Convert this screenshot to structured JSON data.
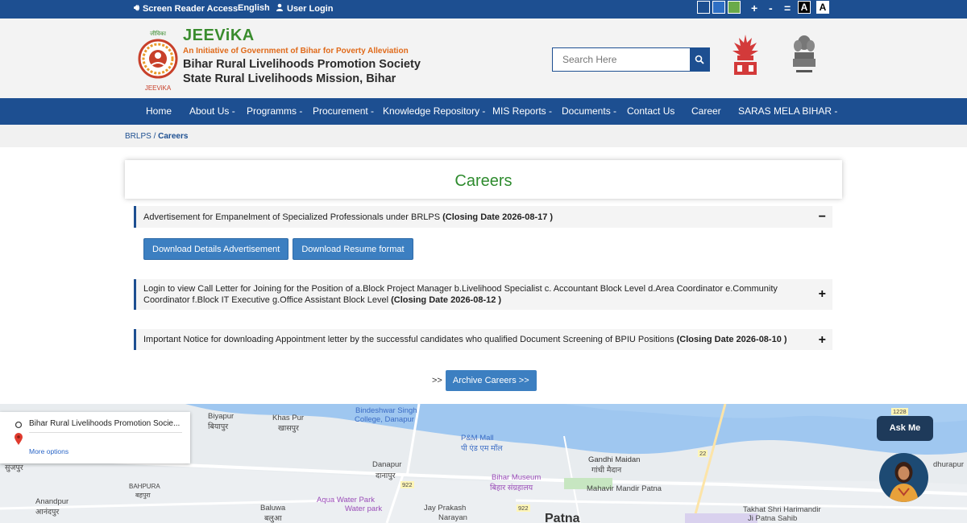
{
  "topbar": {
    "screen_reader": "Screen Reader Access",
    "language": "English",
    "user_login": "User Login",
    "font_increase": "+",
    "font_decrease": "-",
    "font_reset": "=",
    "contrast_dark": "A",
    "contrast_light": "A",
    "theme_colors": [
      "#1d4f91",
      "#2e6fc4",
      "#6aaa4a"
    ]
  },
  "header": {
    "logo_text": "JEEViKA",
    "brand_name": "JEEViKA",
    "tagline": "An Initiative of Government of Bihar for Poverty Alleviation",
    "org_line1": "Bihar Rural Livelihoods Promotion Society",
    "org_line2": "State Rural Livelihoods Mission, Bihar",
    "search_placeholder": "Search Here"
  },
  "nav": {
    "items": [
      {
        "label": "Home"
      },
      {
        "label": "About Us -"
      },
      {
        "label": "Programms -"
      },
      {
        "label": "Procurement -"
      },
      {
        "label": "Knowledge Repository -"
      },
      {
        "label": "MIS Reports -"
      },
      {
        "label": "Documents -"
      },
      {
        "label": "Contact Us"
      },
      {
        "label": "Career"
      },
      {
        "label": "SARAS MELA BIHAR -"
      }
    ]
  },
  "breadcrumb": {
    "root": "BRLPS",
    "separator": " / ",
    "current": "Careers"
  },
  "page": {
    "title": "Careers"
  },
  "careers": [
    {
      "text": "Advertisement for Empanelment of Specialized Professionals under BRLPS",
      "closing": "(Closing Date 2026-08-17 )",
      "sign": "−",
      "buttons": [
        "Download Details Advertisement",
        "Download Resume format"
      ]
    },
    {
      "text": "Login to view Call Letter for Joining for the Position of a.Block Project Manager b.Livelihood Specialist c. Accountant Block Level d.Area Coordinator e.Community Coordinator f.Block IT Executive g.Office Assistant Block Level",
      "closing": "(Closing Date 2026-08-12 )",
      "sign": "+"
    },
    {
      "text": "Important Notice for downloading Appointment letter by the successful candidates who qualified Document Screening of BPIU Positions",
      "closing": "(Closing Date 2026-08-10 )",
      "sign": "+"
    }
  ],
  "archive": {
    "prefix": ">>",
    "label": "Archive Careers >>"
  },
  "map": {
    "info_title": "Bihar Rural Livelihoods Promotion Socie...",
    "info_more": "More options",
    "labels": [
      "Bindeshwar Singh",
      "College, Danapur",
      "Biyapur",
      "बियापुर",
      "Khas Pur",
      "खासपुर",
      "P&M Mall",
      "पी एंड एम मॉल",
      "Danapur",
      "दानापुर",
      "Gandhi Maidan",
      "गांधी मैदान",
      "Bihar Museum",
      "बिहार संग्रहालय",
      "Mahavir Mandir Patna",
      "Aqua Water Park",
      "Water park",
      "Jay Prakash",
      "Narayan",
      "Anandpur",
      "आनंदपुर",
      "Baluwa",
      "बलुआ",
      "BAHPURA",
      "बहपुरा",
      "Takhat Shri Harimandir",
      "Ji Patna Sahib",
      "Patna",
      "dhurapur",
      "सुजपुर"
    ],
    "road_numbers": [
      "922",
      "22",
      "1228"
    ]
  },
  "chatbot": {
    "label": "Ask Me"
  }
}
